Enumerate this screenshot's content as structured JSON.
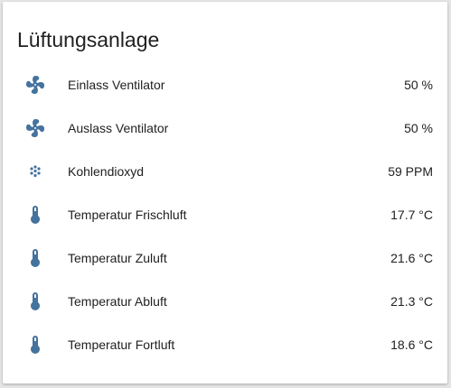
{
  "card": {
    "title": "Lüftungsanlage"
  },
  "colors": {
    "icon": "#44739e",
    "text": "#212121",
    "background": "#e5e5e5",
    "card": "#ffffff"
  },
  "entities": [
    {
      "icon": "fan-icon",
      "name": "Einlass Ventilator",
      "state": "50 %"
    },
    {
      "icon": "fan-icon",
      "name": "Auslass Ventilator",
      "state": "50 %"
    },
    {
      "icon": "molecule-co2-icon",
      "name": "Kohlendioxyd",
      "state": "59 PPM"
    },
    {
      "icon": "thermometer-icon",
      "name": "Temperatur Frischluft",
      "state": "17.7 °C"
    },
    {
      "icon": "thermometer-icon",
      "name": "Temperatur Zuluft",
      "state": "21.6 °C"
    },
    {
      "icon": "thermometer-icon",
      "name": "Temperatur Abluft",
      "state": "21.3 °C"
    },
    {
      "icon": "thermometer-icon",
      "name": "Temperatur Fortluft",
      "state": "18.6 °C"
    }
  ]
}
